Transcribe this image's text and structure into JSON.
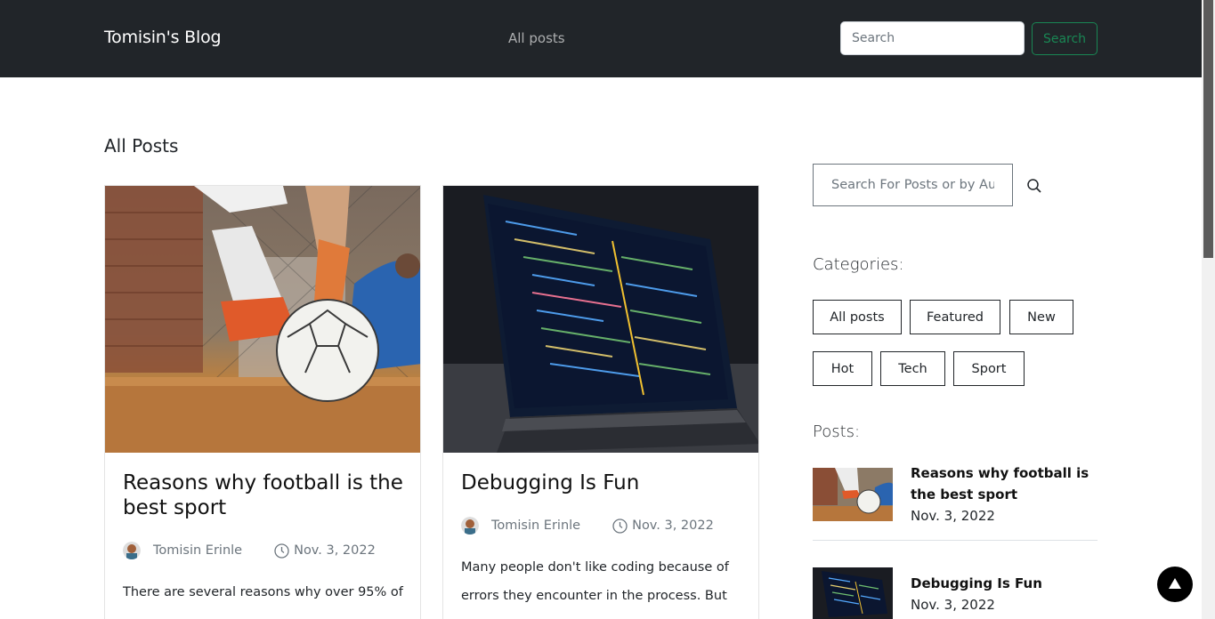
{
  "navbar": {
    "brand": "Tomisin's Blog",
    "link_all_posts": "All posts",
    "search_placeholder": "Search",
    "search_button": "Search"
  },
  "main": {
    "title": "All Posts",
    "posts": [
      {
        "title": "Reasons why football is the best sport",
        "author": "Tomisin Erinle",
        "date": "Nov. 3, 2022",
        "excerpt": "There are several reasons why over 95% of"
      },
      {
        "title": "Debugging Is Fun",
        "author": "Tomisin Erinle",
        "date": "Nov. 3, 2022",
        "excerpt": "Many people don't like coding because of errors they encounter in the process. But"
      }
    ]
  },
  "sidebar": {
    "search_placeholder": "Search For Posts or by Author",
    "categories_heading": "Categories:",
    "categories": [
      "All posts",
      "Featured",
      "New",
      "Hot",
      "Tech",
      "Sport"
    ],
    "posts_heading": "Posts:",
    "posts": [
      {
        "title": "Reasons why football is the best sport",
        "date": "Nov. 3, 2022"
      },
      {
        "title": "Debugging Is Fun",
        "date": "Nov. 3, 2022"
      }
    ]
  },
  "colors": {
    "navbar_bg": "#212529",
    "accent_green": "#198754"
  },
  "icons": {
    "search": "search-icon",
    "clock": "clock-icon",
    "back_to_top": "arrow-up-icon"
  }
}
